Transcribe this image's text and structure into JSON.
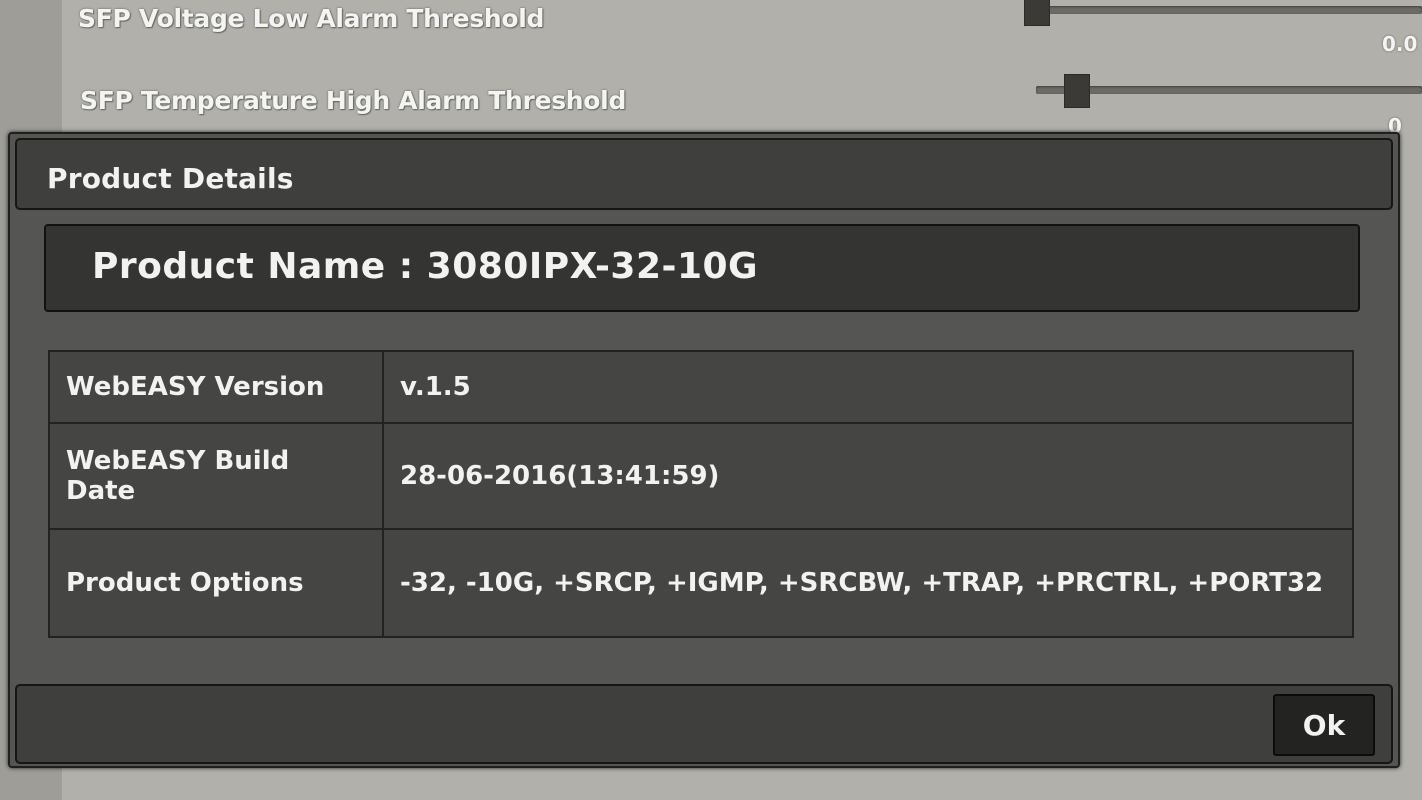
{
  "background": {
    "rows": [
      {
        "label": "SFP Voltage Low Alarm Threshold",
        "value": "0.0"
      },
      {
        "label": "SFP Temperature High Alarm Threshold",
        "value": "0"
      }
    ]
  },
  "dialog": {
    "title": "Product Details",
    "product_name": "Product Name : 3080IPX-32-10G",
    "details": [
      {
        "key": "WebEASY Version",
        "value": "v.1.5"
      },
      {
        "key": "WebEASY Build Date",
        "value": "28-06-2016(13:41:59)"
      },
      {
        "key": "Product Options",
        "value": "-32, -10G, +SRCP, +IGMP, +SRCBW, +TRAP, +PRCTRL, +PORT32"
      }
    ],
    "ok_label": "Ok"
  },
  "colors": {
    "dialog_bg": "#555553",
    "header_bg": "#3f3f3d",
    "text": "#f2f2f0"
  }
}
